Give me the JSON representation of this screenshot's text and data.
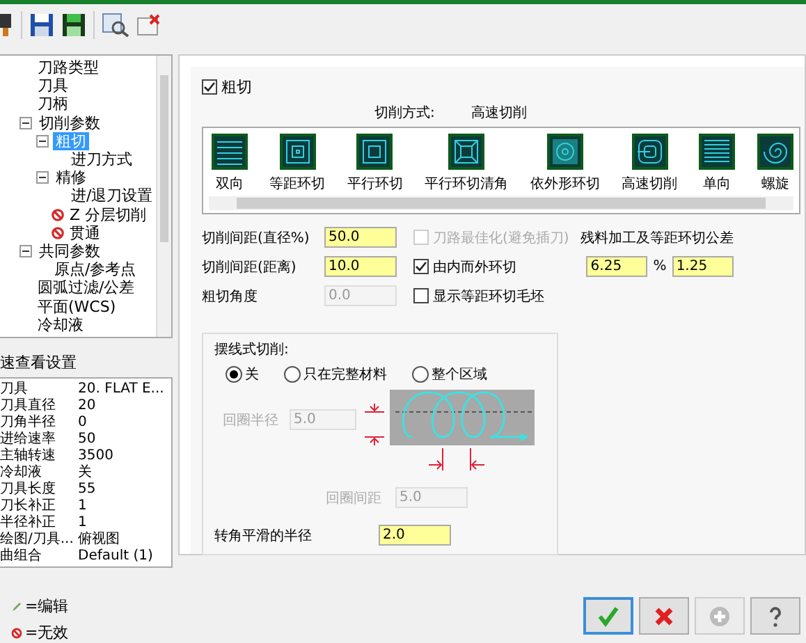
{
  "tree": [
    {
      "label": "刀路类型",
      "selected": false,
      "disabled": false
    },
    {
      "label": "刀具",
      "selected": false,
      "disabled": false
    },
    {
      "label": "刀柄",
      "selected": false,
      "disabled": false
    },
    {
      "label": "切削参数",
      "selected": false,
      "disabled": false,
      "expanded": true,
      "children": [
        {
          "label": "粗切",
          "selected": true,
          "disabled": false,
          "expanded": true,
          "children": [
            {
              "label": "进刀方式",
              "selected": false,
              "disabled": false
            }
          ]
        },
        {
          "label": "精修",
          "selected": false,
          "disabled": false,
          "expanded": true,
          "children": [
            {
              "label": "进/退刀设置",
              "selected": false,
              "disabled": false
            }
          ]
        },
        {
          "label": "Z 分层切削",
          "selected": false,
          "disabled": true
        },
        {
          "label": "贯通",
          "selected": false,
          "disabled": true
        }
      ]
    },
    {
      "label": "共同参数",
      "selected": false,
      "disabled": false,
      "expanded": true,
      "children": [
        {
          "label": "原点/参考点",
          "selected": false,
          "disabled": false
        }
      ]
    },
    {
      "label": "圆弧过滤/公差",
      "selected": false,
      "disabled": false
    },
    {
      "label": "平面(WCS)",
      "selected": false,
      "disabled": false
    },
    {
      "label": "冷却液",
      "selected": false,
      "disabled": false
    }
  ],
  "quick_view": {
    "title": "速查看设置",
    "rows": [
      {
        "label": "刀具",
        "value": "20. FLAT E..."
      },
      {
        "label": "刀具直径",
        "value": "20"
      },
      {
        "label": "刀角半径",
        "value": "0"
      },
      {
        "label": "进给速率",
        "value": "50"
      },
      {
        "label": "主轴转速",
        "value": "3500"
      },
      {
        "label": "冷却液",
        "value": "关"
      },
      {
        "label": "刀具长度",
        "value": "55"
      },
      {
        "label": "刀长补正",
        "value": "1"
      },
      {
        "label": "半径补正",
        "value": "1"
      },
      {
        "label": "绘图/刀具...",
        "value": "俯视图"
      },
      {
        "label": "曲组合",
        "value": "Default (1)"
      }
    ]
  },
  "legend": [
    {
      "kind": "edit",
      "label": "=编辑"
    },
    {
      "kind": "invalid",
      "label": "=无效"
    }
  ],
  "roughing": {
    "enabled": {
      "label": "粗切",
      "checked": true
    },
    "cutting_method": {
      "label": "切削方式:",
      "value": "高速切削"
    },
    "strategies": [
      {
        "kind": "zigzag",
        "label": "双向"
      },
      {
        "kind": "offset",
        "label": "等距环切"
      },
      {
        "kind": "parallel",
        "label": "平行环切"
      },
      {
        "kind": "corner",
        "label": "平行环切清角"
      },
      {
        "kind": "morph",
        "label": "依外形环切"
      },
      {
        "kind": "dynamic",
        "label": "高速切削"
      },
      {
        "kind": "oneway",
        "label": "单向"
      },
      {
        "kind": "spiral",
        "label": "螺旋"
      }
    ],
    "fields": [
      {
        "label": "切削间距(直径%)",
        "value": "50.0",
        "disabled": false
      },
      {
        "label": "切削间距(距离)",
        "value": "10.0",
        "disabled": false
      },
      {
        "label": "粗切角度",
        "value": "0.0",
        "disabled": true
      }
    ],
    "options": [
      {
        "label": "刀路最佳化(避免插刀)",
        "checked": false,
        "disabled": true
      },
      {
        "label": "由内而外环切",
        "checked": true,
        "disabled": false
      },
      {
        "label": "显示等距环切毛坯",
        "checked": false,
        "disabled": false
      }
    ],
    "tolerance": {
      "label": "残料加工及等距环切公差",
      "percent": "6.25",
      "unit": "%",
      "value": "1.25"
    }
  },
  "trochoidal": {
    "title": "摆线式切削:",
    "modes": [
      {
        "label": "关",
        "selected": true
      },
      {
        "label": "只在完整材料",
        "selected": false
      },
      {
        "label": "整个区域",
        "selected": false
      }
    ],
    "loop_radius": {
      "label": "回圈半径",
      "value": "5.0",
      "disabled": true
    },
    "loop_spacing": {
      "label": "回圈间距",
      "value": "5.0",
      "disabled": true
    },
    "corner_radius": {
      "label": "转角平滑的半径",
      "value": "2.0",
      "disabled": false
    }
  },
  "buttons": [
    {
      "kind": "ok",
      "disabled": false
    },
    {
      "kind": "cancel",
      "disabled": false
    },
    {
      "kind": "add",
      "disabled": true
    },
    {
      "kind": "help",
      "disabled": false
    }
  ]
}
